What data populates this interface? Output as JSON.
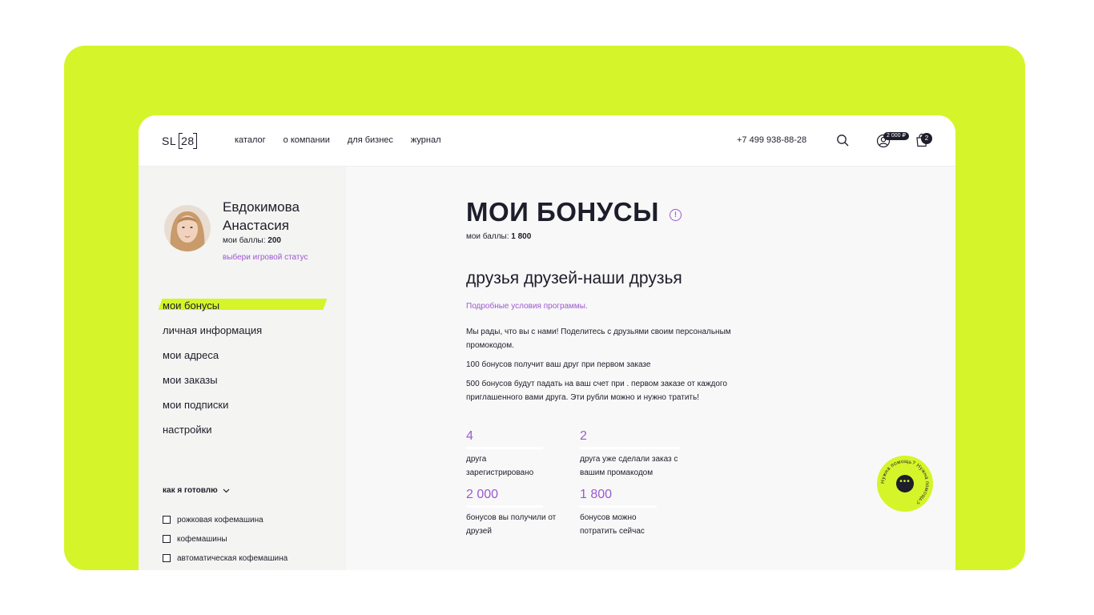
{
  "header": {
    "logo_prefix": "SL",
    "logo_number": "28",
    "nav": [
      "каталог",
      "о компании",
      "для бизнес",
      "журнал"
    ],
    "phone": "+7 499 938-88-28",
    "points_badge": "2 000 ₽",
    "cart_count": "2"
  },
  "profile": {
    "name": "Евдокимова Анастасия",
    "points_label": "мои баллы:",
    "points_value": "200",
    "status_link": "выбери игровой статус"
  },
  "menu": [
    "мои бонусы",
    "личная информация",
    "мои адреса",
    "мои заказы",
    "мои подписки",
    "настройки"
  ],
  "cooking": {
    "heading": "как я готовлю",
    "options": [
      "рожковая кофемашина",
      "кофемашины",
      "автоматическая кофемашина"
    ]
  },
  "main": {
    "title": "МОИ БОНУСЫ",
    "info_icon": "!",
    "balance_label": "мои баллы:",
    "balance_value": "1 800",
    "section_title": "друзья друзей-наши друзья",
    "conditions_link": "Подробные условия программы.",
    "paragraphs": [
      "Мы рады, что вы с нами! Поделитесь с друзьями своим персональным промокодом.",
      "100 бонусов получит ваш друг при первом заказе",
      "500 бонусов будут падать на ваш счет при . первом заказе от каждого приглашенного вами друга. Эти рубли можно и нужно тратить!"
    ],
    "stats": [
      {
        "value": "4",
        "label": "друга зарегистрировано"
      },
      {
        "value": "2",
        "label": "друга уже сделали заказ с вашим промакодом"
      },
      {
        "value": "2 000",
        "label": "бонусов вы получили от друзей"
      },
      {
        "value": "1 800",
        "label": "бонусов можно потратить сейчас"
      }
    ]
  },
  "help": {
    "ring_text": "Нужна помощь? Нужна помощь?",
    "dots": "•••"
  },
  "colors": {
    "accent_lime": "#d5f52a",
    "accent_purple": "#9b59d0",
    "text_dark": "#1d1d2b"
  }
}
